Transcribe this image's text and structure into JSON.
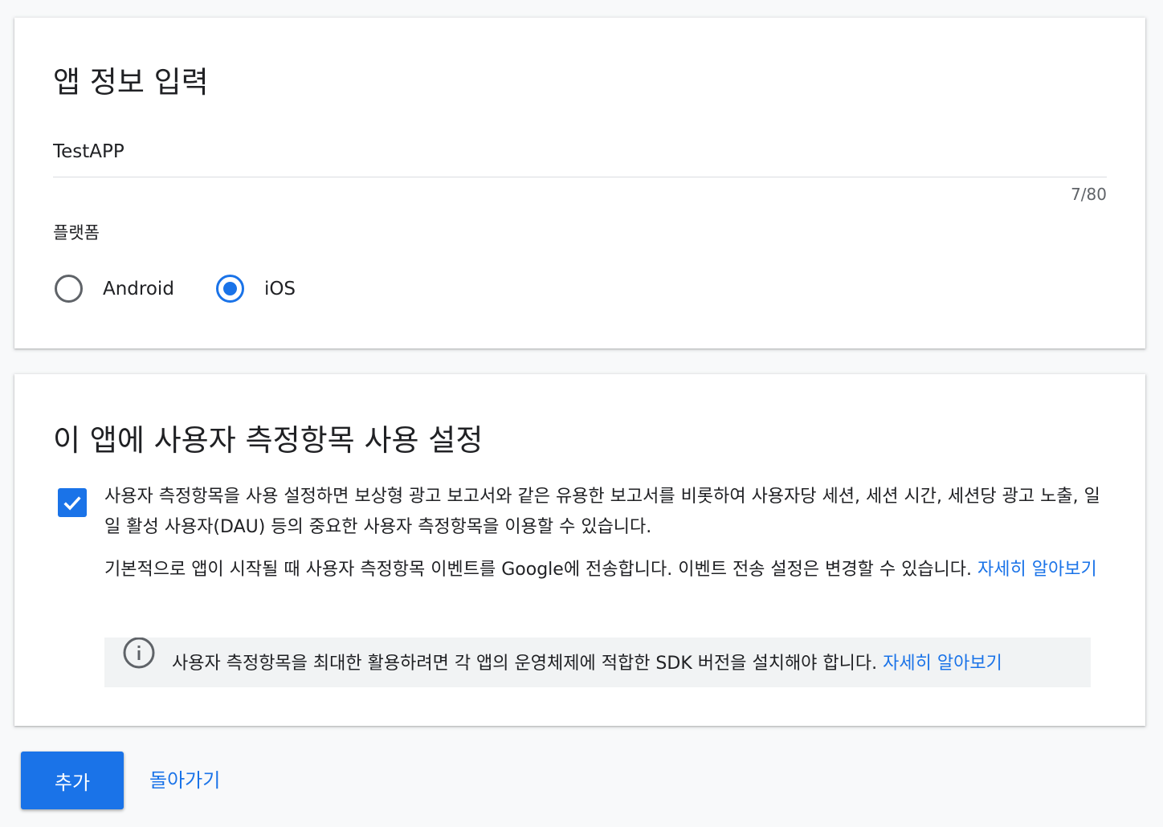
{
  "app_info": {
    "title": "앱 정보 입력",
    "app_name_value": "TestAPP",
    "char_counter": "7/80",
    "platform_label": "플랫폼",
    "platforms": [
      {
        "label": "Android",
        "selected": false
      },
      {
        "label": "iOS",
        "selected": true
      }
    ]
  },
  "metrics": {
    "title": "이 앱에 사용자 측정항목 사용 설정",
    "enabled": true,
    "description": "사용자 측정항목을 사용 설정하면 보상형 광고 보고서와 같은 유용한 보고서를 비롯하여 사용자당 세션, 세션 시간, 세션당 광고 노출, 일일 활성 사용자(DAU) 등의 중요한 사용자 측정항목을 이용할 수 있습니다.",
    "events_text": "기본적으로 앱이 시작될 때 사용자 측정항목 이벤트를 Google에 전송합니다. 이벤트 전송 설정은 변경할 수 있습니다. ",
    "events_link": "자세히 알아보기",
    "info_text": "사용자 측정항목을 최대한 활용하려면 각 앱의 운영체제에 적합한 SDK 버전을 설치해야 합니다. ",
    "info_link": "자세히 알아보기",
    "info_icon": "info-icon"
  },
  "footer": {
    "add_label": "추가",
    "back_label": "돌아가기"
  },
  "colors": {
    "accent": "#1a73e8",
    "background": "#f8f9fa",
    "info_box": "#f1f3f4"
  }
}
